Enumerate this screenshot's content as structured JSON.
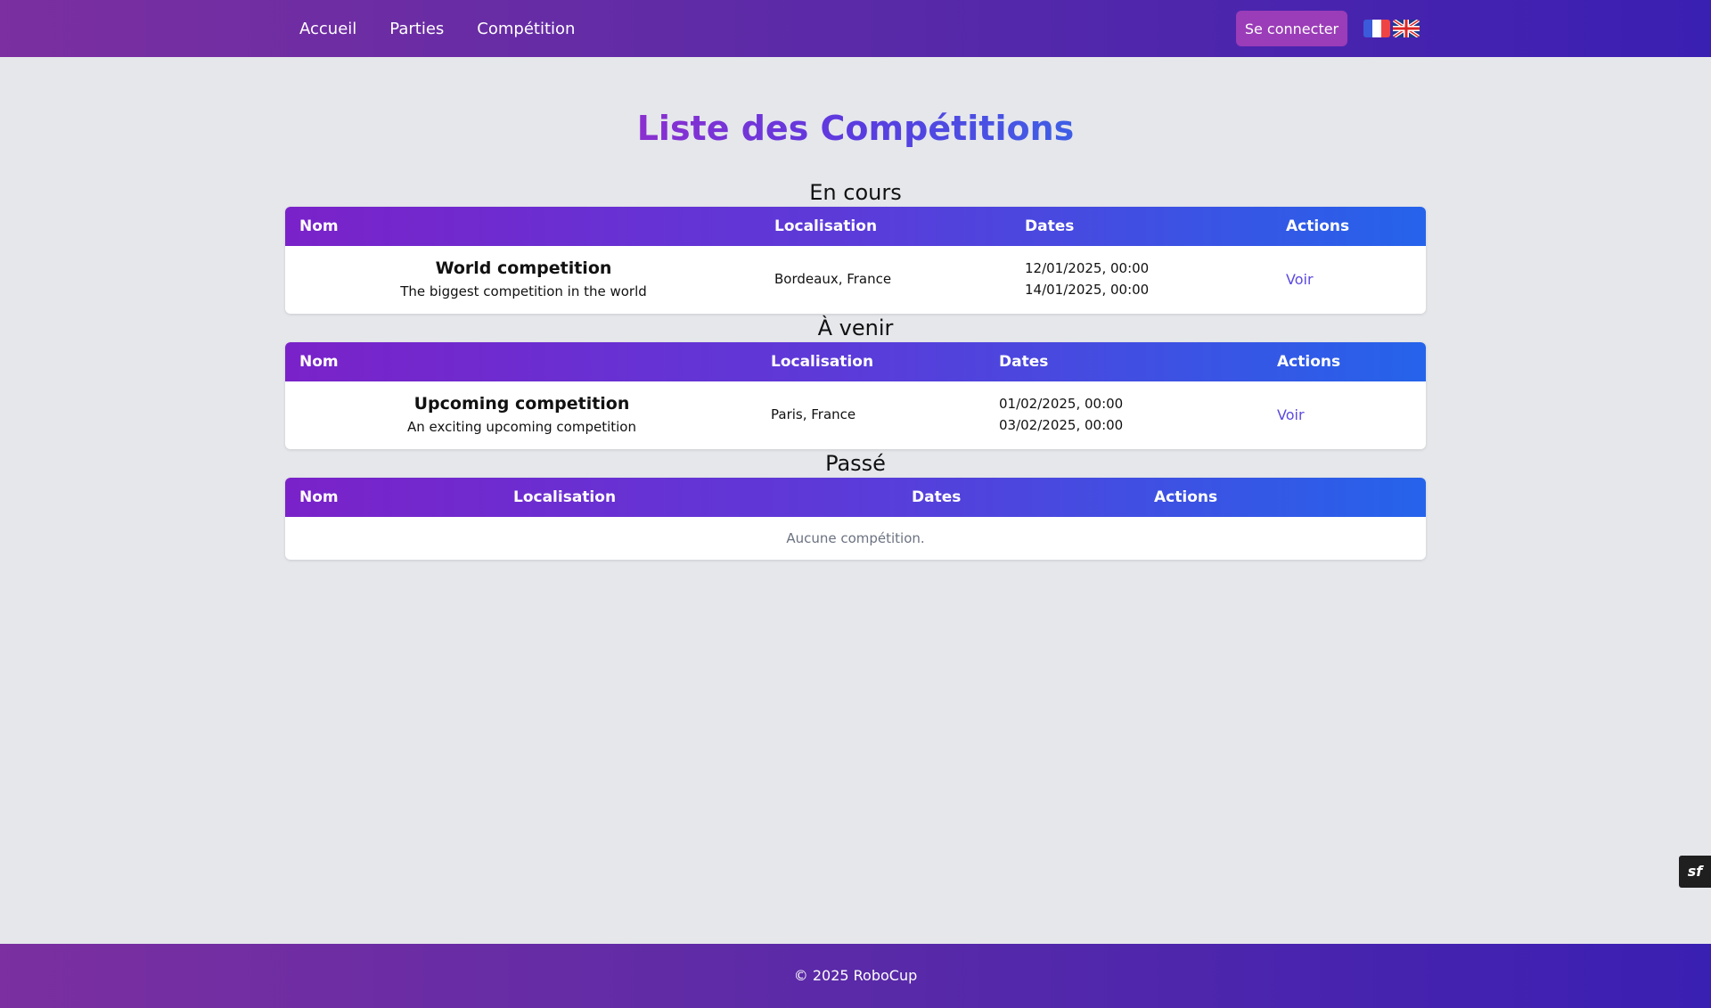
{
  "nav": {
    "links": [
      "Accueil",
      "Parties",
      "Compétition"
    ],
    "login_label": "Se connecter",
    "flags": [
      "flag-fr-icon",
      "flag-uk-icon"
    ]
  },
  "page": {
    "title": "Liste des Compétitions"
  },
  "sections": {
    "current": {
      "title": "En cours",
      "headers": [
        "Nom",
        "Localisation",
        "Dates",
        "Actions"
      ],
      "rows": [
        {
          "name": "World competition",
          "description": "The biggest competition in the world",
          "location": "Bordeaux, France",
          "start": "12/01/2025, 00:00",
          "end": "14/01/2025, 00:00",
          "action": "Voir"
        }
      ]
    },
    "upcoming": {
      "title": "À venir",
      "headers": [
        "Nom",
        "Localisation",
        "Dates",
        "Actions"
      ],
      "rows": [
        {
          "name": "Upcoming competition",
          "description": "An exciting upcoming competition",
          "location": "Paris, France",
          "start": "01/02/2025, 00:00",
          "end": "03/02/2025, 00:00",
          "action": "Voir"
        }
      ]
    },
    "past": {
      "title": "Passé",
      "headers": [
        "Nom",
        "Localisation",
        "Dates",
        "Actions"
      ],
      "empty_message": "Aucune compétition."
    }
  },
  "debug_badge": "sf",
  "footer": {
    "text": "© 2025 RoboCup"
  },
  "colors": {
    "header_gradient_start": "#7b2fa0",
    "header_gradient_end": "#3a1fb3",
    "table_header_start": "#7a22c9",
    "table_header_end": "#2563eb",
    "link": "#5b4ae0",
    "login_button": "#9b3cb8",
    "background": "#e5e7eb"
  }
}
